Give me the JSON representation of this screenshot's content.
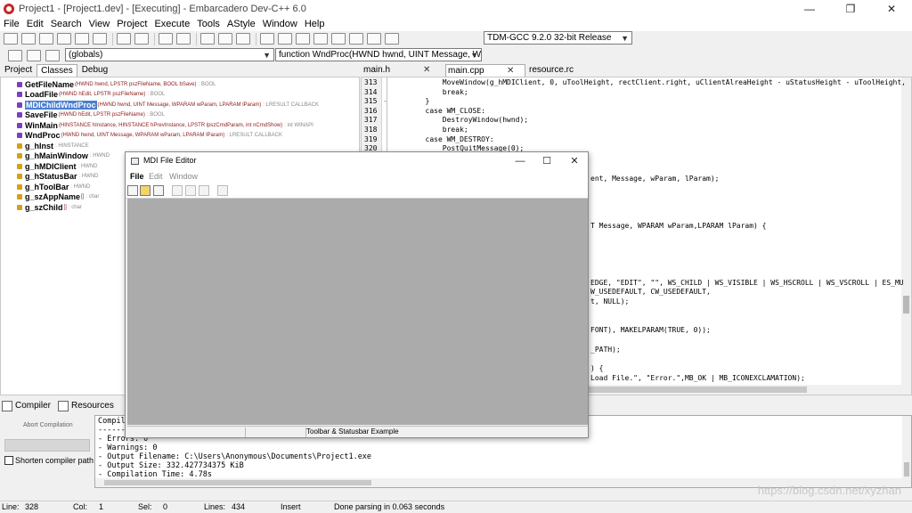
{
  "window": {
    "title": "Project1 - [Project1.dev] - [Executing] - Embarcadero Dev-C++ 6.0",
    "minimize": "—",
    "maximize": "❐",
    "close": "✕"
  },
  "menu": [
    "File",
    "Edit",
    "Search",
    "View",
    "Project",
    "Execute",
    "Tools",
    "AStyle",
    "Window",
    "Help"
  ],
  "toolbar": {
    "compiler": "TDM-GCC 9.2.0 32-bit Release",
    "scope_combo": "(globals)",
    "function_combo": "function WndProc(HWND hwnd, UINT Message, WPAR"
  },
  "left_tabs": [
    "Project",
    "Classes",
    "Debug"
  ],
  "classes": [
    {
      "name": "GetFileName",
      "sig": "(HWND hwnd, LPSTR pszFileName, BOOL bSave)",
      "ret": ": BOOL",
      "color": "#7b3fbf"
    },
    {
      "name": "LoadFile",
      "sig": "(HWND hEdit, LPSTR pszFileName)",
      "ret": ": BOOL",
      "color": "#7b3fbf"
    },
    {
      "name": "MDIChildWndProc",
      "sig": "(HWND hwnd, UINT Message, WPARAM wParam, LPARAM lParam)",
      "ret": ": LRESULT CALLBACK",
      "color": "#7b3fbf"
    },
    {
      "name": "SaveFile",
      "sig": "(HWND hEdit, LPSTR pszFileName)",
      "ret": ": BOOL",
      "color": "#7b3fbf"
    },
    {
      "name": "WinMain",
      "sig": "(HINSTANCE hInstance, HINSTANCE hPrevInstance, LPSTR lpszCmdParam, int nCmdShow)",
      "ret": ": int WINAPI",
      "color": "#7b3fbf"
    },
    {
      "name": "WndProc",
      "sig": "(HWND hwnd, UINT Message, WPARAM wParam, LPARAM lParam)",
      "ret": ": LRESULT CALLBACK",
      "color": "#7b3fbf"
    },
    {
      "name": "g_hInst",
      "sig": "",
      "ret": ": HINSTANCE",
      "color": "#d4a017"
    },
    {
      "name": "g_hMainWindow",
      "sig": "",
      "ret": ": HWND",
      "color": "#d4a017"
    },
    {
      "name": "g_hMDIClient",
      "sig": "",
      "ret": ": HWND",
      "color": "#d4a017"
    },
    {
      "name": "g_hStatusBar",
      "sig": "",
      "ret": ": HWND",
      "color": "#d4a017"
    },
    {
      "name": "g_hToolBar",
      "sig": "",
      "ret": ": HWND",
      "color": "#d4a017"
    },
    {
      "name": "g_szAppName",
      "sig": "[]",
      "ret": ": char",
      "color": "#d4a017"
    },
    {
      "name": "g_szChild",
      "sig": "[]",
      "ret": ": char",
      "color": "#d4a017"
    }
  ],
  "selected_class": "MDIChildWndProc",
  "editor_tabs": [
    {
      "label": "main.h",
      "close": "✕"
    },
    {
      "label": "main.cpp",
      "close": "✕"
    },
    {
      "label": "resource.rc",
      "close": ""
    }
  ],
  "editor": {
    "line_numbers": [
      "313",
      "314",
      "315",
      "316",
      "317",
      "318",
      "319",
      "320"
    ],
    "code_lines": [
      "            MoveWindow(g_hMDIClient, 0, uToolHeight, rectClient.right, uClientAlreaHeight - uStatusHeight - uToolHeight,",
      "            break;",
      "        }",
      "        case WM_CLOSE:",
      "            DestroyWindow(hwnd);",
      "            break;",
      "        case WM_DESTROY:",
      "            PostQuitMessage(0);"
    ],
    "visible_fragments": [
      "ent, Message, wParam, lParam);",
      "T Message, WPARAM wParam,LPARAM lParam) {",
      "EDGE, \"EDIT\", \"\", WS_CHILD | WS_VISIBLE | WS_HSCROLL | WS_VSCROLL | ES_MU",
      "W_USEDEFAULT, CW_USEDEFAULT,",
      "t, NULL);",
      "FONT), MAKELPARAM(TRUE, 0));",
      "_PATH);",
      ") {",
      "Load File.\", \"Error.\",MB_OK | MB_ICONEXCLAMATION);"
    ]
  },
  "bottom_tabs": [
    "Compiler",
    "Resources"
  ],
  "abort_label": "Abort Compilation",
  "shorten_label": "Shorten compiler path",
  "log": [
    "Compil",
    "-------",
    "- Errors: 0",
    "- Warnings: 0",
    "- Output Filename: C:\\Users\\Anonymous\\Documents\\Project1.exe",
    "- Output Size: 332.427734375 KiB",
    "- Compilation Time: 4.78s"
  ],
  "status": {
    "line_label": "Line:",
    "line": "328",
    "col_label": "Col:",
    "col": "1",
    "sel_label": "Sel:",
    "sel": "0",
    "lines_label": "Lines:",
    "lines": "434",
    "mode": "Insert",
    "message": "Done parsing in 0.063 seconds"
  },
  "watermark": "https://blog.csdn.net/xyzhan",
  "mdi": {
    "title": "MDI File Editor",
    "menu": [
      "File",
      "Edit",
      "Window"
    ],
    "status_text": "Toolbar & Statusbar Example",
    "minimize": "—",
    "maximize": "☐",
    "close": "✕"
  }
}
